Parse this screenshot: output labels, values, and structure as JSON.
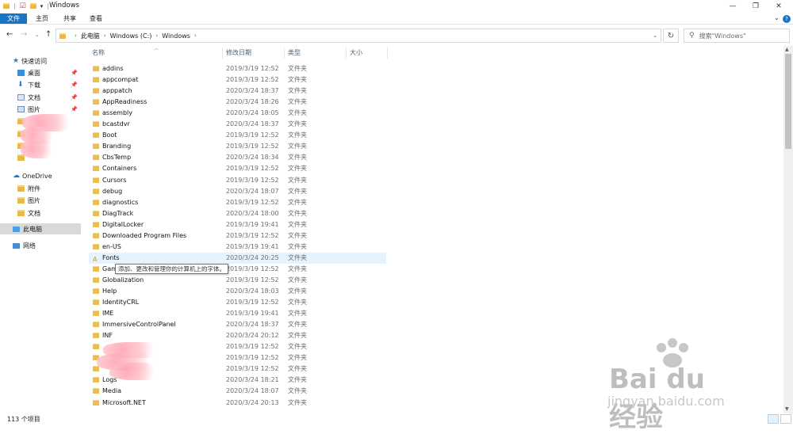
{
  "window": {
    "title": "Windows"
  },
  "ribbon": {
    "tabs": [
      "文件",
      "主页",
      "共享",
      "查看"
    ],
    "help": "?"
  },
  "address": {
    "crumbs": [
      "此电脑",
      "Windows (C:)",
      "Windows"
    ]
  },
  "search": {
    "placeholder": "搜索\"Windows\""
  },
  "nav": {
    "quick_access": "快速访问",
    "quick_items": [
      "桌面",
      "下载",
      "文档",
      "图片"
    ],
    "onedrive": "OneDrive",
    "onedrive_items": [
      "附件",
      "图片",
      "文档"
    ],
    "this_pc": "此电脑",
    "network": "网络"
  },
  "columns": {
    "name": "名称",
    "date": "修改日期",
    "type": "类型",
    "size": "大小"
  },
  "files": [
    {
      "name": "addins",
      "date": "2019/3/19 12:52",
      "type": "文件夹"
    },
    {
      "name": "appcompat",
      "date": "2019/3/19 12:52",
      "type": "文件夹"
    },
    {
      "name": "apppatch",
      "date": "2020/3/24 18:37",
      "type": "文件夹"
    },
    {
      "name": "AppReadiness",
      "date": "2020/3/24 18:26",
      "type": "文件夹"
    },
    {
      "name": "assembly",
      "date": "2020/3/24 18:05",
      "type": "文件夹"
    },
    {
      "name": "bcastdvr",
      "date": "2020/3/24 18:37",
      "type": "文件夹"
    },
    {
      "name": "Boot",
      "date": "2019/3/19 12:52",
      "type": "文件夹"
    },
    {
      "name": "Branding",
      "date": "2019/3/19 12:52",
      "type": "文件夹"
    },
    {
      "name": "CbsTemp",
      "date": "2020/3/24 18:34",
      "type": "文件夹"
    },
    {
      "name": "Containers",
      "date": "2019/3/19 12:52",
      "type": "文件夹"
    },
    {
      "name": "Cursors",
      "date": "2019/3/19 12:52",
      "type": "文件夹"
    },
    {
      "name": "debug",
      "date": "2020/3/24 18:07",
      "type": "文件夹"
    },
    {
      "name": "diagnostics",
      "date": "2019/3/19 12:52",
      "type": "文件夹"
    },
    {
      "name": "DiagTrack",
      "date": "2020/3/24 18:00",
      "type": "文件夹"
    },
    {
      "name": "DigitalLocker",
      "date": "2019/3/19 19:41",
      "type": "文件夹"
    },
    {
      "name": "Downloaded Program Files",
      "date": "2019/3/19 12:52",
      "type": "文件夹"
    },
    {
      "name": "en-US",
      "date": "2019/3/19 19:41",
      "type": "文件夹"
    },
    {
      "name": "Fonts",
      "date": "2020/3/24 20:25",
      "type": "文件夹"
    },
    {
      "name": "Gam",
      "date": "2019/3/19 12:52",
      "type": "文件夹"
    },
    {
      "name": "Globalization",
      "date": "2019/3/19 12:52",
      "type": "文件夹"
    },
    {
      "name": "Help",
      "date": "2020/3/24 18:03",
      "type": "文件夹"
    },
    {
      "name": "IdentityCRL",
      "date": "2019/3/19 12:52",
      "type": "文件夹"
    },
    {
      "name": "IME",
      "date": "2019/3/19 19:41",
      "type": "文件夹"
    },
    {
      "name": "ImmersiveControlPanel",
      "date": "2020/3/24 18:37",
      "type": "文件夹"
    },
    {
      "name": "INF",
      "date": "2020/3/24 20:12",
      "type": "文件夹"
    },
    {
      "name": "",
      "date": "2019/3/19 12:52",
      "type": "文件夹"
    },
    {
      "name": "",
      "date": "2019/3/19 12:52",
      "type": "文件夹"
    },
    {
      "name": "",
      "date": "2019/3/19 12:52",
      "type": "文件夹"
    },
    {
      "name": "Logs",
      "date": "2020/3/24 18:21",
      "type": "文件夹"
    },
    {
      "name": "Media",
      "date": "2020/3/24 18:07",
      "type": "文件夹"
    },
    {
      "name": "Microsoft.NET",
      "date": "2020/3/24 20:13",
      "type": "文件夹"
    }
  ],
  "tooltip": "添加、更改和管理你的计算机上的字体。",
  "status": {
    "count": "113 个项目"
  },
  "watermark": {
    "brand": "Bai du 经验",
    "url": "jingyan.baidu.com"
  }
}
